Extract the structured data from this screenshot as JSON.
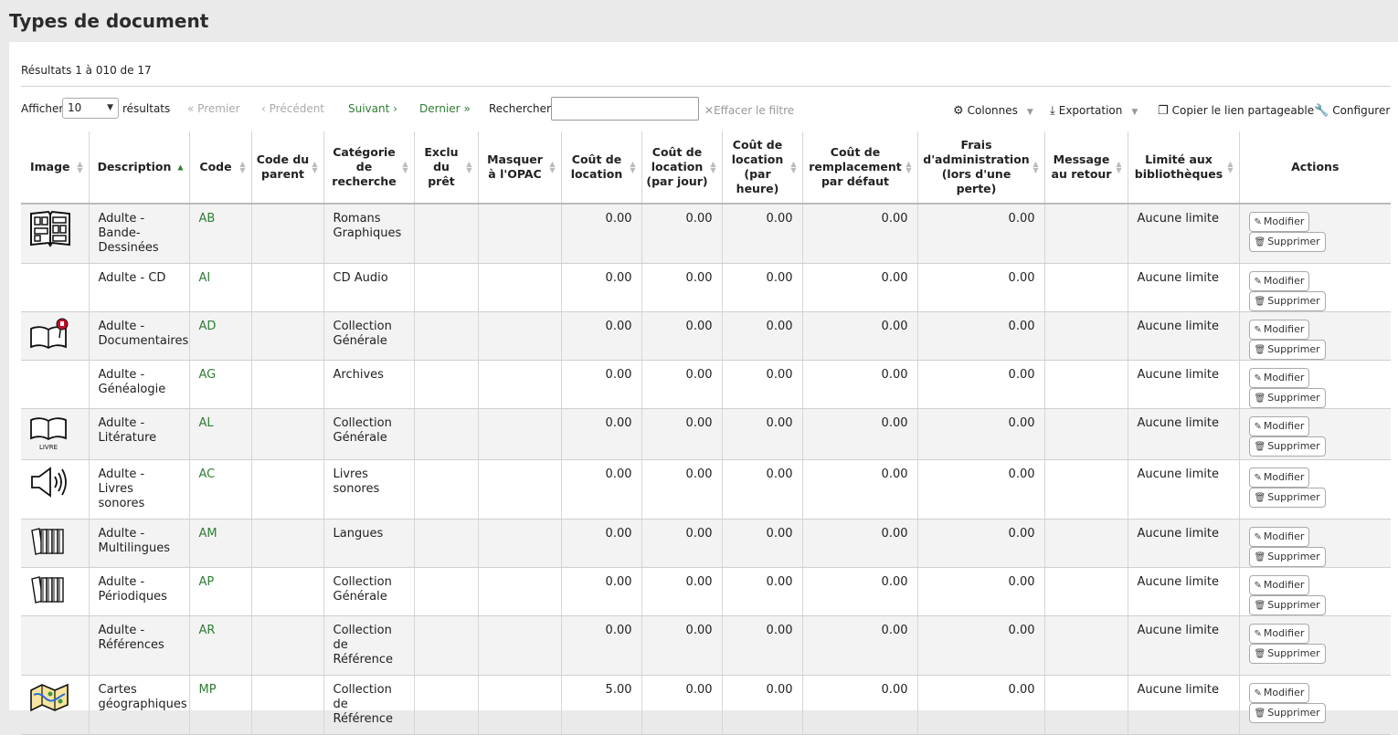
{
  "page_title": "Types de document",
  "results_info": "Résultats 1 à 010 de 17",
  "toolbar": {
    "show_label": "Afficher",
    "page_size": "10",
    "results_label": "résultats",
    "first": "Premier",
    "previous": "Précédent",
    "next": "Suivant",
    "last": "Dernier",
    "search_label": "Rechercher :",
    "search_value": "",
    "clear_filter": "Effacer le filtre",
    "columns": "Colonnes",
    "export": "Exportation",
    "copy_link": "Copier le lien partageable",
    "configure": "Configurer"
  },
  "columns": [
    "Image",
    "Description",
    "Code",
    "Code du parent",
    "Catégorie de recherche",
    "Exclu du prêt",
    "Masquer à l'OPAC",
    "Coût de location",
    "Coût de location (par jour)",
    "Coût de location (par heure)",
    "Coût de remplacement par défaut",
    "Frais d'administration (lors d'une perte)",
    "Message au retour",
    "Limité aux bibliothèques",
    "Actions"
  ],
  "rows": [
    {
      "icon": "comic-strip-icon",
      "description": "Adulte - Bande-Dessinées",
      "code": "AB",
      "parent": "",
      "category": "Romans Graphiques",
      "excluded": "",
      "hidden": "",
      "rental": "0.00",
      "rental_day": "0.00",
      "rental_hour": "0.00",
      "replacement": "0.00",
      "admin_fee": "0.00",
      "message": "",
      "limited": "Aucune limite"
    },
    {
      "icon": "",
      "description": "Adulte - CD",
      "code": "AI",
      "parent": "",
      "category": "CD Audio",
      "excluded": "",
      "hidden": "",
      "rental": "0.00",
      "rental_day": "0.00",
      "rental_hour": "0.00",
      "replacement": "0.00",
      "admin_fee": "0.00",
      "message": "",
      "limited": "Aucune limite"
    },
    {
      "icon": "book-marker-icon",
      "description": "Adulte - Documentaires",
      "code": "AD",
      "parent": "",
      "category": "Collection Générale",
      "excluded": "",
      "hidden": "",
      "rental": "0.00",
      "rental_day": "0.00",
      "rental_hour": "0.00",
      "replacement": "0.00",
      "admin_fee": "0.00",
      "message": "",
      "limited": "Aucune limite"
    },
    {
      "icon": "",
      "description": "Adulte - Généalogie",
      "code": "AG",
      "parent": "",
      "category": "Archives",
      "excluded": "",
      "hidden": "",
      "rental": "0.00",
      "rental_day": "0.00",
      "rental_hour": "0.00",
      "replacement": "0.00",
      "admin_fee": "0.00",
      "message": "",
      "limited": "Aucune limite"
    },
    {
      "icon": "open-book-icon",
      "description": "Adulte - Litérature",
      "code": "AL",
      "parent": "",
      "category": "Collection Générale",
      "excluded": "",
      "hidden": "",
      "rental": "0.00",
      "rental_day": "0.00",
      "rental_hour": "0.00",
      "replacement": "0.00",
      "admin_fee": "0.00",
      "message": "",
      "limited": "Aucune limite"
    },
    {
      "icon": "speaker-icon",
      "description": "Adulte - Livres sonores",
      "code": "AC",
      "parent": "",
      "category": "Livres sonores",
      "excluded": "",
      "hidden": "",
      "rental": "0.00",
      "rental_day": "0.00",
      "rental_hour": "0.00",
      "replacement": "0.00",
      "admin_fee": "0.00",
      "message": "",
      "limited": "Aucune limite"
    },
    {
      "icon": "books-icon",
      "description": "Adulte - Multilingues",
      "code": "AM",
      "parent": "",
      "category": "Langues",
      "excluded": "",
      "hidden": "",
      "rental": "0.00",
      "rental_day": "0.00",
      "rental_hour": "0.00",
      "replacement": "0.00",
      "admin_fee": "0.00",
      "message": "",
      "limited": "Aucune limite"
    },
    {
      "icon": "books-icon",
      "description": "Adulte - Périodiques",
      "code": "AP",
      "parent": "",
      "category": "Collection Générale",
      "excluded": "",
      "hidden": "",
      "rental": "0.00",
      "rental_day": "0.00",
      "rental_hour": "0.00",
      "replacement": "0.00",
      "admin_fee": "0.00",
      "message": "",
      "limited": "Aucune limite"
    },
    {
      "icon": "",
      "description": "Adulte - Références",
      "code": "AR",
      "parent": "",
      "category": "Collection de Référence",
      "excluded": "",
      "hidden": "",
      "rental": "0.00",
      "rental_day": "0.00",
      "rental_hour": "0.00",
      "replacement": "0.00",
      "admin_fee": "0.00",
      "message": "",
      "limited": "Aucune limite"
    },
    {
      "icon": "map-icon",
      "description": "Cartes géographiques",
      "code": "MP",
      "parent": "",
      "category": "Collection de Référence",
      "excluded": "",
      "hidden": "",
      "rental": "5.00",
      "rental_day": "0.00",
      "rental_hour": "0.00",
      "replacement": "0.00",
      "admin_fee": "0.00",
      "message": "",
      "limited": "Aucune limite"
    }
  ],
  "actions": {
    "edit": "Modifier",
    "delete": "Supprimer"
  },
  "icon_book_caption": "LIVRE",
  "colors": {
    "accent": "#2e7d32",
    "background": "#eaeaea"
  }
}
